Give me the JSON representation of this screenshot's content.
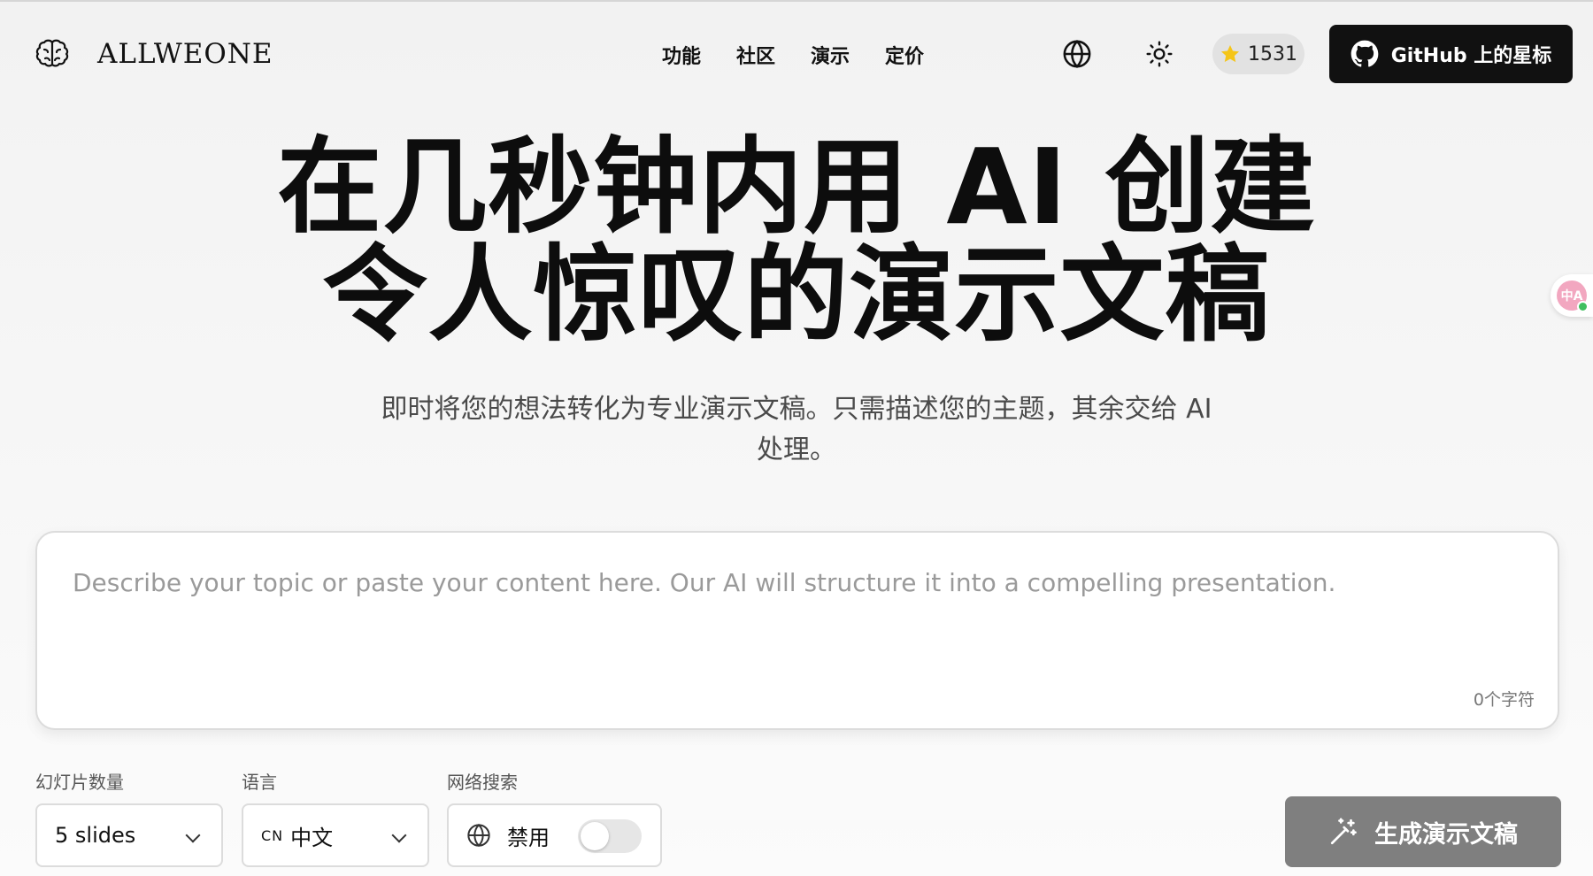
{
  "nav": {
    "brand": "ALLWEONE",
    "menu": [
      "功能",
      "社区",
      "演示",
      "定价"
    ],
    "stars": "1531",
    "github_label": "GitHub 上的星标"
  },
  "hero": {
    "title_line1": "在几秒钟内用 AI 创建",
    "title_line2": "令人惊叹的演示文稿",
    "subtitle_line1": "即时将您的想法转化为专业演示文稿。只需描述您的主题，其余交给 AI",
    "subtitle_line2": "处理。"
  },
  "prompt": {
    "placeholder": "Describe your topic or paste your content here. Our AI will structure it into a compelling presentation.",
    "value": "",
    "char_count": "0个字符"
  },
  "controls": {
    "slides_label": "幻灯片数量",
    "slides_value": "5 slides",
    "language_label": "语言",
    "language_code": "CN",
    "language_value": "中文",
    "websearch_label": "网络搜索",
    "websearch_value": "禁用",
    "websearch_enabled": false
  },
  "generate": {
    "label": "生成演示文稿"
  },
  "colors": {
    "primary_button": "#111111",
    "disabled_button": "#7f7f7f",
    "star": "#f5c518"
  },
  "icons": [
    "brain-icon",
    "globe-icon",
    "sun-icon",
    "star-icon",
    "github-icon",
    "chevron-down-icon",
    "magic-wand-icon",
    "translate-icon"
  ]
}
